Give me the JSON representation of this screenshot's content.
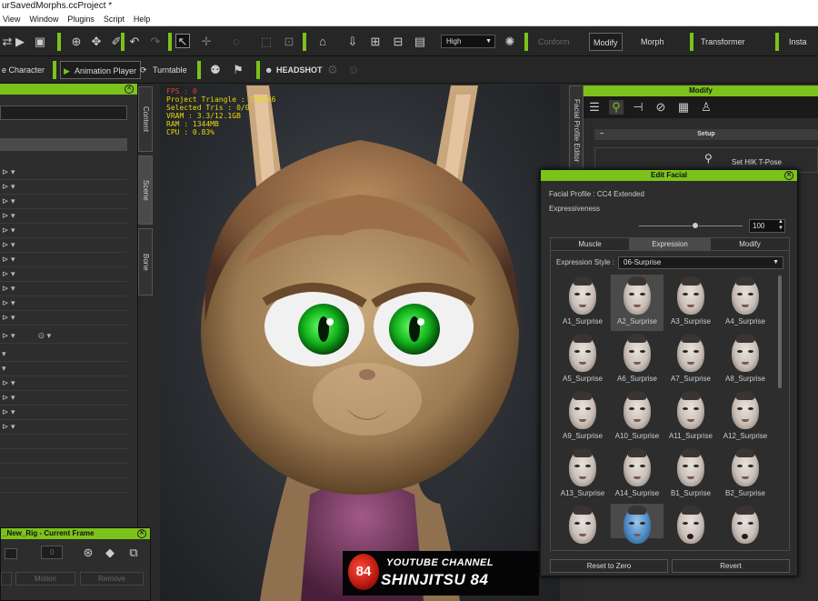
{
  "window": {
    "title": "urSavedMorphs.ccProject *"
  },
  "menu": [
    "View",
    "Window",
    "Plugins",
    "Script",
    "Help"
  ],
  "toolbar1": {
    "quality": "High",
    "conform_label": "Conform",
    "modify_label": "Modify",
    "morph_label": "Morph",
    "transformer_label": "Transformer",
    "install_label": "Insta"
  },
  "toolbar2": {
    "character_label": "e Character",
    "animation_player_label": "Animation Player",
    "turntable_label": "Turntable",
    "headshot_label": "HEADSHOT"
  },
  "side_tabs": [
    "Content",
    "Scene",
    "Bone"
  ],
  "viewport_stats": {
    "fps": "FPS : 0",
    "lines": [
      "Project Triangle : 138366",
      "Selected Tris : 0/0",
      "VRAM : 3.3/12.1GB",
      "RAM : 1344MB",
      "CPU : 0.83%"
    ]
  },
  "modify_panel": {
    "vertical_tab": "Facial Profile Editor",
    "title": "Modify",
    "setup_label": "Setup",
    "hik_label": "Set HIK T-Pose"
  },
  "edit_facial": {
    "title": "Edit Facial",
    "profile_label": "Facial Profile : CC4 Extended",
    "expressiveness_label": "Expressiveness",
    "expressiveness_value": "100",
    "expressiveness_level": 1.0,
    "tabs": [
      "Muscle",
      "Expression",
      "Modify"
    ],
    "active_tab": "Expression",
    "style_label": "Expression Style :",
    "style_value": "06-Surprise",
    "expressions": [
      "A1_Surprise",
      "A2_Surprise",
      "A3_Surprise",
      "A4_Surprise",
      "A5_Surprise",
      "A6_Surprise",
      "A7_Surprise",
      "A8_Surprise",
      "A9_Surprise",
      "A10_Surprise",
      "A11_Surprise",
      "A12_Surprise",
      "A13_Surprise",
      "A14_Surprise",
      "B1_Surprise",
      "B2_Surprise"
    ],
    "selected_expression": "A2_Surprise",
    "reset_label": "Reset to Zero",
    "revert_label": "Revert"
  },
  "rig_panel": {
    "title": "_New_Rig - Current Frame",
    "motion_label": "Motion",
    "remove_label": "Remove",
    "value": "0"
  },
  "watermark": {
    "logo": "84",
    "line1": "YOUTUBE CHANNEL",
    "line2": "SHINJITSU 84"
  }
}
